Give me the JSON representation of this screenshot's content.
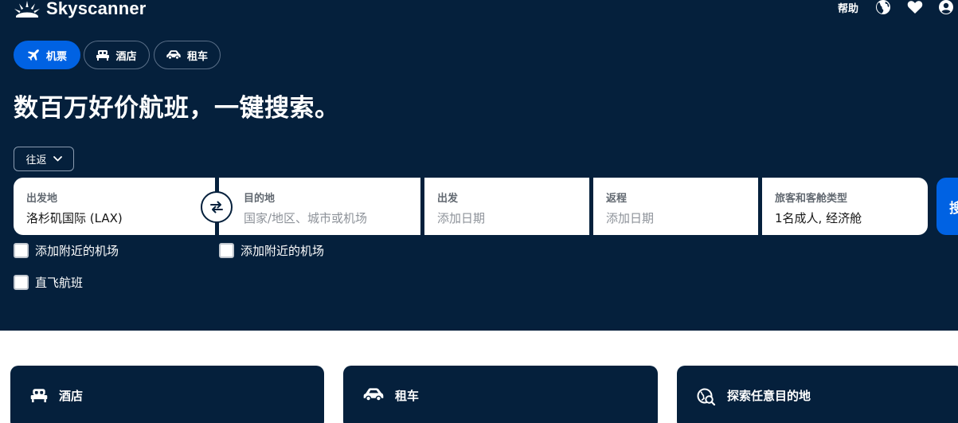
{
  "header": {
    "brand": "Skyscanner",
    "help": "帮助",
    "icons": [
      "globe-icon",
      "heart-icon",
      "account-icon"
    ]
  },
  "tabs": [
    {
      "label": "机票",
      "icon": "plane-icon",
      "active": true
    },
    {
      "label": "酒店",
      "icon": "bed-icon",
      "active": false
    },
    {
      "label": "租车",
      "icon": "car-icon",
      "active": false
    }
  ],
  "headline": "数百万好价航班，一键搜索。",
  "trip_type": {
    "selected": "往返",
    "icon": "chevron-down-icon"
  },
  "search": {
    "origin": {
      "label": "出发地",
      "value": "洛杉矶国际 (LAX)"
    },
    "destination": {
      "label": "目的地",
      "placeholder": "国家/地区、城市或机场"
    },
    "depart": {
      "label": "出发",
      "placeholder": "添加日期"
    },
    "return": {
      "label": "返程",
      "placeholder": "添加日期"
    },
    "passengers": {
      "label": "旅客和客舱类型",
      "value": "1名成人, 经济舱"
    },
    "button_label": "搜"
  },
  "options": {
    "origin_nearby": "添加附近的机场",
    "dest_nearby": "添加附近的机场",
    "direct": "直飞航班"
  },
  "cards": [
    {
      "label": "酒店",
      "icon": "bed-icon"
    },
    {
      "label": "租车",
      "icon": "car-icon"
    },
    {
      "label": "探索任意目的地",
      "icon": "explore-globe-icon"
    }
  ],
  "colors": {
    "navy": "#05203c",
    "accent_blue": "#0062e3",
    "white": "#ffffff"
  }
}
